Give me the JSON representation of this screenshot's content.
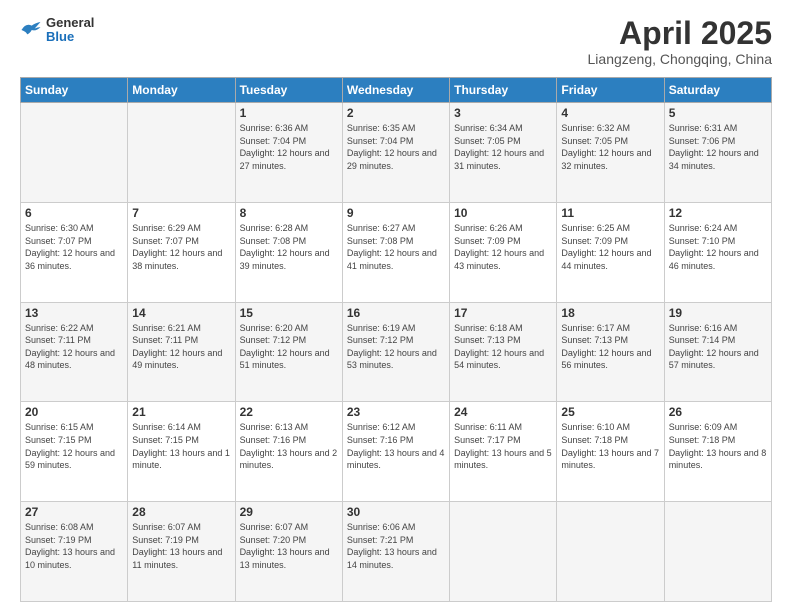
{
  "header": {
    "logo_general": "General",
    "logo_blue": "Blue",
    "month_title": "April 2025",
    "subtitle": "Liangzeng, Chongqing, China"
  },
  "weekdays": [
    "Sunday",
    "Monday",
    "Tuesday",
    "Wednesday",
    "Thursday",
    "Friday",
    "Saturday"
  ],
  "weeks": [
    [
      {
        "day": "",
        "info": ""
      },
      {
        "day": "",
        "info": ""
      },
      {
        "day": "1",
        "info": "Sunrise: 6:36 AM\nSunset: 7:04 PM\nDaylight: 12 hours and 27 minutes."
      },
      {
        "day": "2",
        "info": "Sunrise: 6:35 AM\nSunset: 7:04 PM\nDaylight: 12 hours and 29 minutes."
      },
      {
        "day": "3",
        "info": "Sunrise: 6:34 AM\nSunset: 7:05 PM\nDaylight: 12 hours and 31 minutes."
      },
      {
        "day": "4",
        "info": "Sunrise: 6:32 AM\nSunset: 7:05 PM\nDaylight: 12 hours and 32 minutes."
      },
      {
        "day": "5",
        "info": "Sunrise: 6:31 AM\nSunset: 7:06 PM\nDaylight: 12 hours and 34 minutes."
      }
    ],
    [
      {
        "day": "6",
        "info": "Sunrise: 6:30 AM\nSunset: 7:07 PM\nDaylight: 12 hours and 36 minutes."
      },
      {
        "day": "7",
        "info": "Sunrise: 6:29 AM\nSunset: 7:07 PM\nDaylight: 12 hours and 38 minutes."
      },
      {
        "day": "8",
        "info": "Sunrise: 6:28 AM\nSunset: 7:08 PM\nDaylight: 12 hours and 39 minutes."
      },
      {
        "day": "9",
        "info": "Sunrise: 6:27 AM\nSunset: 7:08 PM\nDaylight: 12 hours and 41 minutes."
      },
      {
        "day": "10",
        "info": "Sunrise: 6:26 AM\nSunset: 7:09 PM\nDaylight: 12 hours and 43 minutes."
      },
      {
        "day": "11",
        "info": "Sunrise: 6:25 AM\nSunset: 7:09 PM\nDaylight: 12 hours and 44 minutes."
      },
      {
        "day": "12",
        "info": "Sunrise: 6:24 AM\nSunset: 7:10 PM\nDaylight: 12 hours and 46 minutes."
      }
    ],
    [
      {
        "day": "13",
        "info": "Sunrise: 6:22 AM\nSunset: 7:11 PM\nDaylight: 12 hours and 48 minutes."
      },
      {
        "day": "14",
        "info": "Sunrise: 6:21 AM\nSunset: 7:11 PM\nDaylight: 12 hours and 49 minutes."
      },
      {
        "day": "15",
        "info": "Sunrise: 6:20 AM\nSunset: 7:12 PM\nDaylight: 12 hours and 51 minutes."
      },
      {
        "day": "16",
        "info": "Sunrise: 6:19 AM\nSunset: 7:12 PM\nDaylight: 12 hours and 53 minutes."
      },
      {
        "day": "17",
        "info": "Sunrise: 6:18 AM\nSunset: 7:13 PM\nDaylight: 12 hours and 54 minutes."
      },
      {
        "day": "18",
        "info": "Sunrise: 6:17 AM\nSunset: 7:13 PM\nDaylight: 12 hours and 56 minutes."
      },
      {
        "day": "19",
        "info": "Sunrise: 6:16 AM\nSunset: 7:14 PM\nDaylight: 12 hours and 57 minutes."
      }
    ],
    [
      {
        "day": "20",
        "info": "Sunrise: 6:15 AM\nSunset: 7:15 PM\nDaylight: 12 hours and 59 minutes."
      },
      {
        "day": "21",
        "info": "Sunrise: 6:14 AM\nSunset: 7:15 PM\nDaylight: 13 hours and 1 minute."
      },
      {
        "day": "22",
        "info": "Sunrise: 6:13 AM\nSunset: 7:16 PM\nDaylight: 13 hours and 2 minutes."
      },
      {
        "day": "23",
        "info": "Sunrise: 6:12 AM\nSunset: 7:16 PM\nDaylight: 13 hours and 4 minutes."
      },
      {
        "day": "24",
        "info": "Sunrise: 6:11 AM\nSunset: 7:17 PM\nDaylight: 13 hours and 5 minutes."
      },
      {
        "day": "25",
        "info": "Sunrise: 6:10 AM\nSunset: 7:18 PM\nDaylight: 13 hours and 7 minutes."
      },
      {
        "day": "26",
        "info": "Sunrise: 6:09 AM\nSunset: 7:18 PM\nDaylight: 13 hours and 8 minutes."
      }
    ],
    [
      {
        "day": "27",
        "info": "Sunrise: 6:08 AM\nSunset: 7:19 PM\nDaylight: 13 hours and 10 minutes."
      },
      {
        "day": "28",
        "info": "Sunrise: 6:07 AM\nSunset: 7:19 PM\nDaylight: 13 hours and 11 minutes."
      },
      {
        "day": "29",
        "info": "Sunrise: 6:07 AM\nSunset: 7:20 PM\nDaylight: 13 hours and 13 minutes."
      },
      {
        "day": "30",
        "info": "Sunrise: 6:06 AM\nSunset: 7:21 PM\nDaylight: 13 hours and 14 minutes."
      },
      {
        "day": "",
        "info": ""
      },
      {
        "day": "",
        "info": ""
      },
      {
        "day": "",
        "info": ""
      }
    ]
  ]
}
